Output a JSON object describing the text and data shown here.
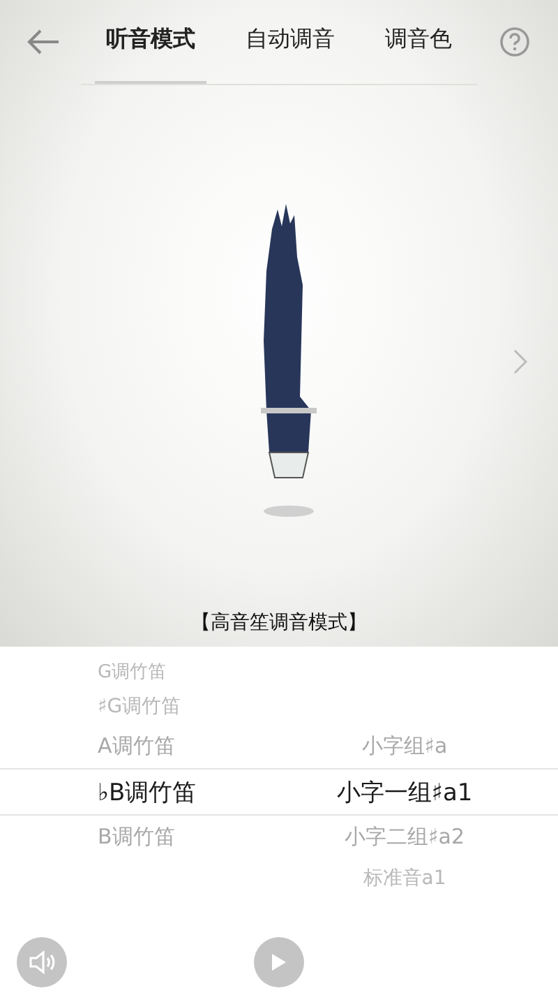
{
  "tabs": [
    {
      "label": "听音模式",
      "selected": true
    },
    {
      "label": "自动调音",
      "selected": false
    },
    {
      "label": "调音色",
      "selected": false
    }
  ],
  "caption": "【高音笙调音模式】",
  "picker": [
    {
      "left": "G调竹笛",
      "selected": false
    },
    {
      "left": "♯G调竹笛",
      "selected": false
    },
    {
      "left": "A调竹笛",
      "right": "小字组♯a",
      "selected": false
    },
    {
      "left": "♭B调竹笛",
      "right": "小字一组♯a1",
      "selected": true
    },
    {
      "left": "B调竹笛",
      "right": "小字二组♯a2",
      "selected": false
    },
    {
      "right": "标准音a1",
      "selected": false
    }
  ]
}
